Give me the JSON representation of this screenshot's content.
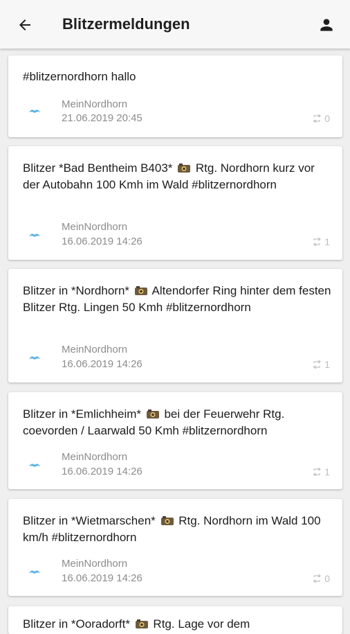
{
  "appbar": {
    "title": "Blitzermeldungen",
    "back_icon": "arrow-back-icon",
    "account_icon": "account-icon"
  },
  "posts": [
    {
      "text_parts": [
        "#blitzernordhorn hallo"
      ],
      "author": "MeinNordhorn",
      "date": "21.06.2019 20:45",
      "share_count": "0"
    },
    {
      "text_parts": [
        "Blitzer *Bad Bentheim B403*",
        "Rtg. Nordhorn kurz vor der Autobahn 100 Kmh im Wald #blitzernordhorn"
      ],
      "author": "MeinNordhorn",
      "date": "16.06.2019 14:26",
      "share_count": "1"
    },
    {
      "text_parts": [
        "Blitzer in *Nordhorn*",
        "Altendorfer Ring hinter dem festen Blitzer Rtg. Lingen 50 Kmh #blitzernordhorn"
      ],
      "author": "MeinNordhorn",
      "date": "16.06.2019 14:26",
      "share_count": "1"
    },
    {
      "text_parts": [
        "Blitzer in *Emlichheim*",
        "bei der Feuerwehr Rtg. coevorden / Laarwald 50 Kmh #blitzernordhorn"
      ],
      "author": "MeinNordhorn",
      "date": "16.06.2019 14:26",
      "share_count": "1"
    },
    {
      "text_parts": [
        "Blitzer in *Wietmarschen*",
        "Rtg. Nordhorn im Wald 100 km/h #blitzernordhorn"
      ],
      "author": "MeinNordhorn",
      "date": "16.06.2019 14:26",
      "share_count": "0"
    },
    {
      "text_parts": [
        "Blitzer in *Ooradorft*",
        "Rtg. Lage vor dem"
      ],
      "author": "",
      "date": "",
      "share_count": ""
    }
  ],
  "colors": {
    "accent": "#5ab4e6",
    "card_bg": "#ffffff",
    "page_bg": "#efefef",
    "meta_text": "#8c8c8c"
  }
}
